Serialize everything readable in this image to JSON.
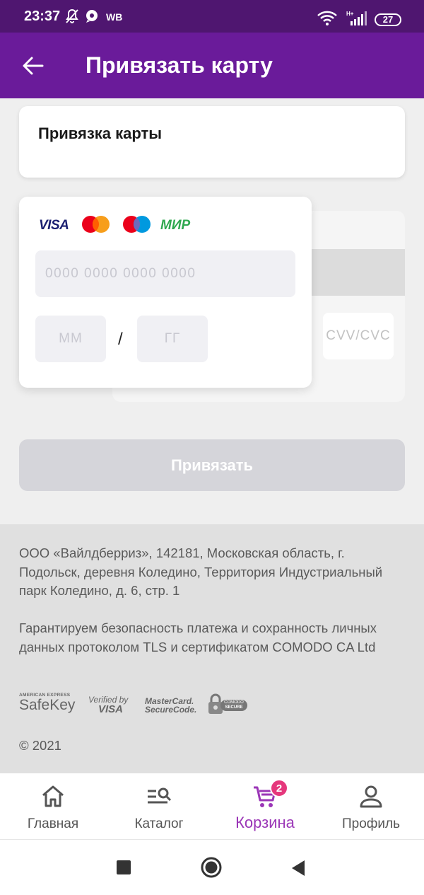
{
  "status_bar": {
    "time": "23:37",
    "carrier": "WB",
    "network": "H+",
    "battery": "27"
  },
  "app_bar": {
    "title": "Привязать карту"
  },
  "card_header": {
    "title": "Привязка карты"
  },
  "card_form": {
    "brands": [
      "VISA",
      "Mastercard",
      "Maestro",
      "МИР"
    ],
    "visa_label": "VISA",
    "mir_label": "МИР",
    "number_placeholder": "0000 0000 0000 0000",
    "month_placeholder": "ММ",
    "year_placeholder": "ГГ",
    "separator": "/",
    "cvv_placeholder": "CVV/CVC"
  },
  "submit_label": "Привязать",
  "footer": {
    "address": "ООО «Вайлдберриз», 142181, Московская область, г. Подольск, деревня Коледино, Территория Индустриальный парк Коледино, д. 6, стр. 1",
    "security": "Гарантируем безопасность платежа и сохранность личных данных протоколом TLS и сертификатом COMODO CA Ltd",
    "badges": {
      "amex_top": "AMERICAN EXPRESS",
      "amex_main": "SafeKey",
      "verified_top": "Verified by",
      "verified_main": "VISA",
      "mc_top": "MasterCard.",
      "mc_main": "SecureCode.",
      "comodo_top": "COMODO",
      "comodo_main": "SECURE"
    },
    "copyright": "© 2021"
  },
  "bottom_nav": {
    "items": [
      {
        "label": "Главная",
        "icon": "home-icon"
      },
      {
        "label": "Каталог",
        "icon": "catalog-search-icon"
      },
      {
        "label": "Корзина",
        "icon": "cart-icon",
        "active": true,
        "badge": "2"
      },
      {
        "label": "Профиль",
        "icon": "profile-icon"
      }
    ]
  },
  "colors": {
    "status_bar": "#4f1670",
    "app_bar": "#6a1b9a",
    "active_nav": "#9b36b7",
    "badge": "#e5377c",
    "button_disabled": "#d5d5da"
  }
}
